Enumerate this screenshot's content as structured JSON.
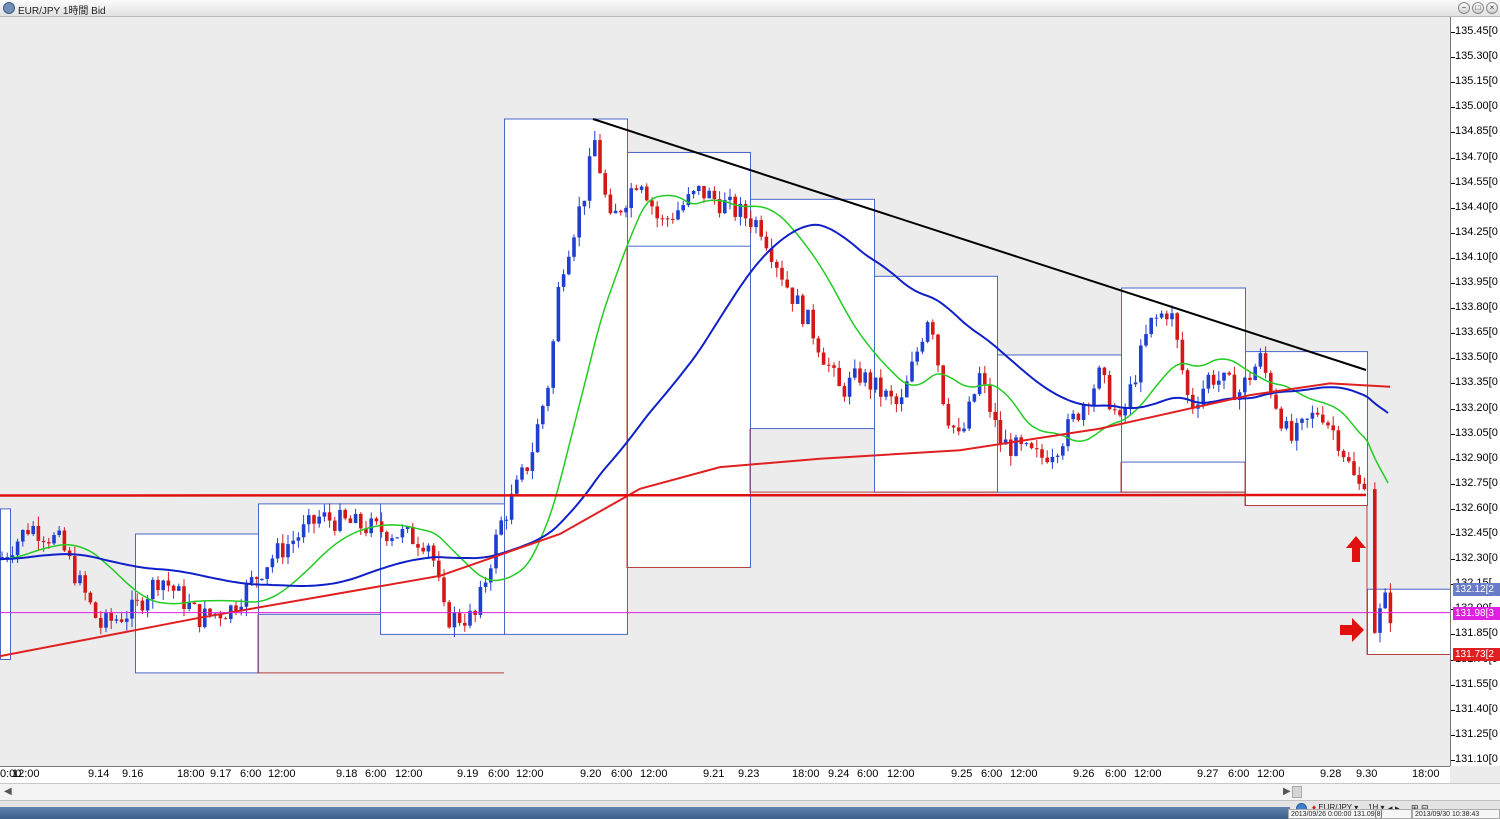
{
  "window": {
    "title": "EUR/JPY 1時間 Bid",
    "buttons": [
      "−",
      "□",
      "×"
    ]
  },
  "colors": {
    "bull": "#1f3fd0",
    "bear": "#d41818",
    "ma_fast": "#22cc22",
    "ma_mid": "#1020c8",
    "ma_slow": "#e02020",
    "trendline": "#000000",
    "support": "#e01010",
    "bid_line": "#e020e0",
    "box_up": "#4a68c8",
    "box_down": "#b84040"
  },
  "price_axis": {
    "ticks": [
      "135.45[0",
      "135.30[0",
      "135.15[0",
      "135.00[0",
      "134.85[0",
      "134.70[0",
      "134.55[0",
      "134.40[0",
      "134.25[0",
      "134.10[0",
      "133.95[0",
      "133.80[0",
      "133.65[0",
      "133.50[0",
      "133.35[0",
      "133.20[0",
      "133.05[0",
      "132.90[0",
      "132.75[0",
      "132.60[0",
      "132.45[0",
      "132.30[0",
      "132.15[",
      "132.00[",
      "131.85[0",
      "131.70[0",
      "131.55[0",
      "131.40[0",
      "131.25[0",
      "131.10[0"
    ],
    "current_high": "132.12[2",
    "current_bid": "131.98[3",
    "current_low": "131.73[2"
  },
  "time_axis": {
    "labels": [
      "0:00",
      "12:00",
      "9.14",
      "9.16",
      "18:00",
      "9.17",
      "6:00",
      "12:00",
      "9.18",
      "6:00",
      "12:00",
      "9.19",
      "6:00",
      "12:00",
      "9.20",
      "6:00",
      "12:00",
      "9.21",
      "9.23",
      "18:00",
      "9.24",
      "6:00",
      "12:00",
      "9.25",
      "6:00",
      "12:00",
      "9.26",
      "6:00",
      "12:00",
      "9.27",
      "6:00",
      "12:00",
      "9.28",
      "9.30",
      "18:00"
    ]
  },
  "statusbar": {
    "symbol": "EUR/JPY",
    "timeframe": "1H",
    "cursor_info": "2013/09/26 0:00:00  131.09[8]",
    "clock": "2013/09/30 10:38:43"
  },
  "chart_data": {
    "type": "candlestick",
    "title": "EUR/JPY 1時間 Bid",
    "ylim": [
      131.05,
      135.55
    ],
    "y_axis": "price",
    "support_level": 132.68,
    "bid_line": 131.98,
    "trendline": [
      {
        "x": "9.20",
        "y": 134.93
      },
      {
        "x": "9.28",
        "y": 133.43
      }
    ],
    "annotations": [
      "up-arrow at 9.28 low",
      "right-arrow at 9.30 bid"
    ],
    "session_boxes": [
      {
        "start": "9.13",
        "end": "9.14",
        "high": 132.6,
        "low": 131.7
      },
      {
        "start": "9.16",
        "end": "9.17",
        "high": 132.45,
        "low": 131.62
      },
      {
        "start": "9.17",
        "end": "9.18",
        "high": 132.63,
        "low": 131.97
      },
      {
        "start": "9.18",
        "end": "9.19",
        "high": 132.63,
        "low": 131.85
      },
      {
        "start": "9.19",
        "end": "9.20",
        "high": 134.93,
        "low": 131.85
      },
      {
        "start": "9.20",
        "end": "9.21",
        "high": 134.73,
        "low": 132.25
      },
      {
        "start": "9.21",
        "end": "9.23",
        "high": 134.73,
        "low": 134.17
      },
      {
        "start": "9.23",
        "end": "9.24",
        "high": 134.45,
        "low": 133.08
      },
      {
        "start": "9.24",
        "end": "9.25",
        "high": 133.99,
        "low": 132.7
      },
      {
        "start": "9.25",
        "end": "9.26",
        "high": 133.52,
        "low": 132.7
      },
      {
        "start": "9.26",
        "end": "9.27",
        "high": 133.92,
        "low": 132.7
      },
      {
        "start": "9.27",
        "end": "9.28",
        "high": 133.92,
        "low": 132.88
      },
      {
        "start": "9.28",
        "end": "9.30",
        "high": 133.54,
        "low": 132.62
      },
      {
        "start": "9.30",
        "end": "10.01",
        "high": 132.12,
        "low": 131.73
      }
    ]
  }
}
